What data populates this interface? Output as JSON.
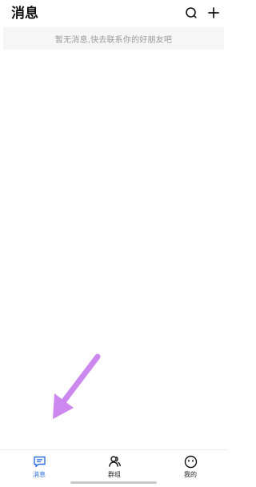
{
  "header": {
    "title": "消息",
    "search_icon": "search-icon",
    "add_icon": "plus-icon"
  },
  "empty_state": {
    "text": "暂无消息,快去联系你的好朋友吧"
  },
  "tabbar": {
    "tabs": [
      {
        "label": "消息",
        "icon": "message-icon",
        "active": true
      },
      {
        "label": "群组",
        "icon": "group-icon",
        "active": false
      },
      {
        "label": "我的",
        "icon": "profile-icon",
        "active": false
      }
    ]
  },
  "colors": {
    "accent": "#2f6fde",
    "arrow": "#cc88ee",
    "banner_bg": "#f6f6f7",
    "muted_text": "#9a9a9a"
  }
}
